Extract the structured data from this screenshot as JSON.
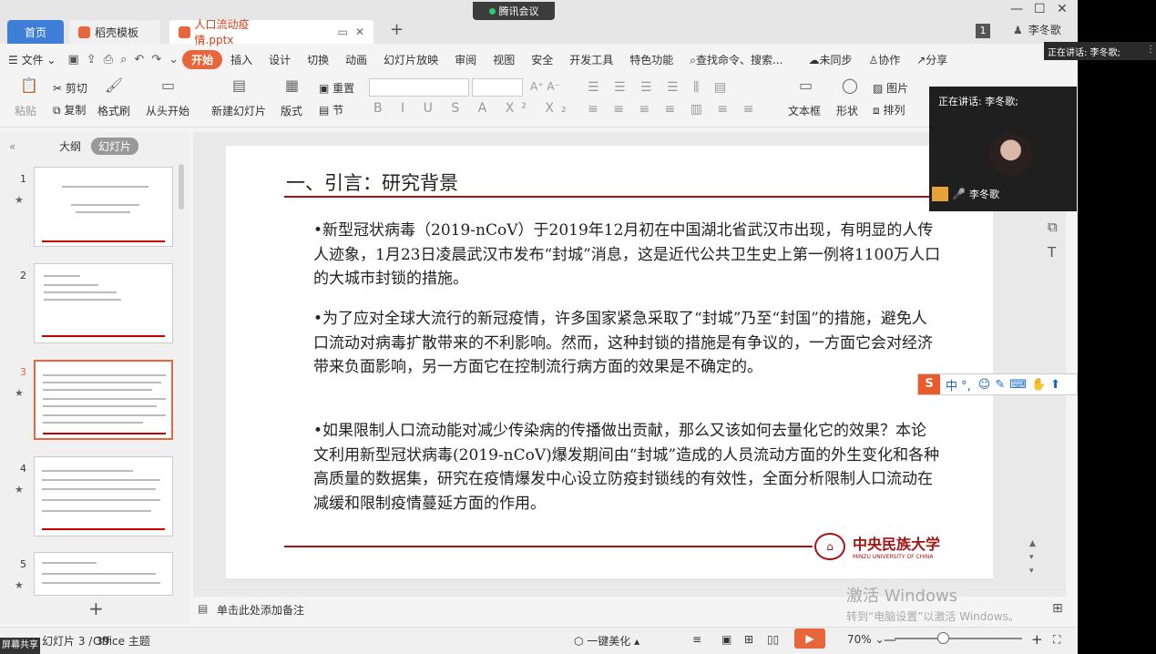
{
  "tabs": {
    "home": "首页",
    "template": "稻壳模板",
    "doc": "人口流动疫情.pptx"
  },
  "meeting": "腾讯会议",
  "user": "李冬歌",
  "page_badge": "1",
  "menu": {
    "file": "文件",
    "items": [
      "开始",
      "插入",
      "设计",
      "切换",
      "动画",
      "幻灯片放映",
      "审阅",
      "视图",
      "安全",
      "开发工具",
      "特色功能"
    ],
    "search": "查找命令、搜索...",
    "sync": "未同步",
    "collab": "协作",
    "share": "分享"
  },
  "ribbon": {
    "paste": "粘贴",
    "cut": "剪切",
    "copy": "复制",
    "format_painter": "格式刷",
    "from_start": "从头开始",
    "new_slide": "新建幻灯片",
    "layout": "版式",
    "section": "节",
    "reset": "重置",
    "textbox": "文本框",
    "shape": "形状",
    "arrange": "排列",
    "image": "图片"
  },
  "panel": {
    "outline": "大纲",
    "slides": "幻灯片"
  },
  "slide": {
    "title": "一、引言：研究背景",
    "bullets": [
      "•新型冠状病毒（2019-nCoV）于2019年12月初在中国湖北省武汉市出现，有明显的人传人迹象，1月23日凌晨武汉市发布“封城”消息，这是近代公共卫生史上第一例将1100万人口的大城市封锁的措施。",
      "•为了应对全球大流行的新冠疫情，许多国家紧急采取了“封城”乃至“封国”的措施，避免人口流动对病毒扩散带来的不利影响。然而，这种封锁的措施是有争议的，一方面它会对经济带来负面影响，另一方面它在控制流行病方面的效果是不确定的。",
      "•如果限制人口流动能对减少传染病的传播做出贡献，那么又该如何去量化它的效果？本论文利用新型冠状病毒(2019-nCoV)爆发期间由“封城”造成的人员流动方面的外生变化和各种高质量的数据集，研究在疫情爆发中心设立防疫封锁线的有效性，全面分析限制人口流动在减缓和限制疫情蔓延方面的作用。"
    ],
    "logo_cn": "中央民族大学",
    "logo_en": "MINZU UNIVERSITY OF CHINA"
  },
  "thumbs": [
    "1",
    "2",
    "3",
    "4",
    "5"
  ],
  "notes": "单击此处添加备注",
  "status": {
    "slide": "幻灯片 3 / 39",
    "theme": "Office 主题",
    "beautify": "一键美化",
    "zoom": "70%"
  },
  "watermark": {
    "l1": "激活 Windows",
    "l2": "转到“电脑设置”以激活 Windows。"
  },
  "video": {
    "speaking": "正在讲话: 李冬歌;",
    "name": "李冬歌",
    "pill": "正在讲话: 李冬歌;"
  },
  "ime": "中 °,",
  "share_label": "屏幕共享"
}
